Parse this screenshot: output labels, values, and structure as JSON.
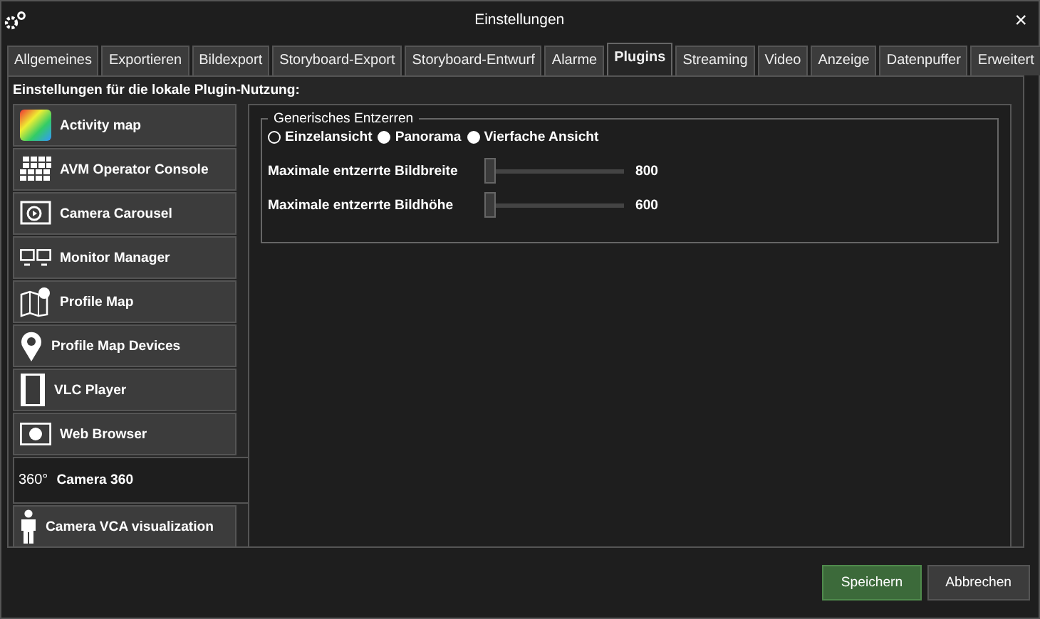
{
  "window": {
    "title": "Einstellungen",
    "close": "×"
  },
  "tabs": [
    {
      "label": "Allgemeines",
      "selected": false
    },
    {
      "label": "Exportieren",
      "selected": false
    },
    {
      "label": "Bildexport",
      "selected": false
    },
    {
      "label": "Storyboard-Export",
      "selected": false
    },
    {
      "label": "Storyboard-Entwurf",
      "selected": false
    },
    {
      "label": "Alarme",
      "selected": false
    },
    {
      "label": "Plugins",
      "selected": true
    },
    {
      "label": "Streaming",
      "selected": false
    },
    {
      "label": "Video",
      "selected": false
    },
    {
      "label": "Anzeige",
      "selected": false
    },
    {
      "label": "Datenpuffer",
      "selected": false
    },
    {
      "label": "Erweitert",
      "selected": false
    }
  ],
  "heading": "Einstellungen für die lokale Plugin-Nutzung:",
  "plugins": [
    {
      "label": "Activity map",
      "kind": "heatmap",
      "selected": false
    },
    {
      "label": "AVM Operator Console",
      "kind": "grid",
      "selected": false
    },
    {
      "label": "Camera Carousel",
      "kind": "carousel",
      "selected": false
    },
    {
      "label": "Monitor Manager",
      "kind": "monitors",
      "selected": false
    },
    {
      "label": "Profile Map",
      "kind": "map",
      "selected": false
    },
    {
      "label": "Profile Map Devices",
      "kind": "pin",
      "selected": false
    },
    {
      "label": "VLC Player",
      "kind": "film",
      "selected": false
    },
    {
      "label": "Web Browser",
      "kind": "globe",
      "selected": false
    },
    {
      "label": "Camera 360",
      "kind": "text",
      "icon_text": "360°",
      "selected": true
    },
    {
      "label": "Camera VCA visualization",
      "kind": "person",
      "selected": false
    }
  ],
  "group": {
    "title": "Generisches Entzerren",
    "radios": [
      {
        "label": "Einzelansicht",
        "selected": true
      },
      {
        "label": "Panorama",
        "selected": false
      },
      {
        "label": "Vierfache Ansicht",
        "selected": false
      }
    ],
    "sliders": [
      {
        "label": "Maximale entzerrte Bildbreite",
        "level": 0,
        "reading": "800"
      },
      {
        "label": "Maximale entzerrte Bildhöhe",
        "level": 0,
        "reading": "600"
      }
    ]
  },
  "buttons": [
    {
      "label": "Speichern",
      "kind": "primary"
    },
    {
      "label": "Abbrechen",
      "kind": "secondary"
    }
  ]
}
